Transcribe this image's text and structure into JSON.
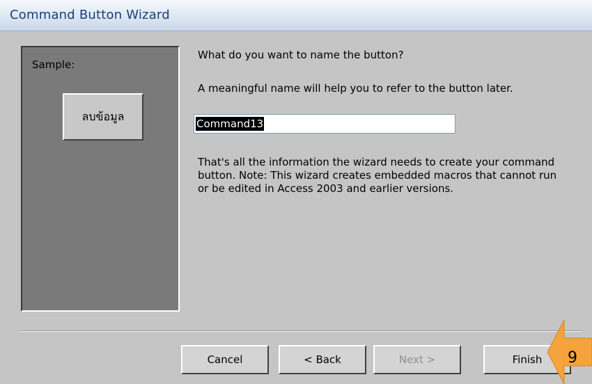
{
  "window": {
    "title": "Command Button Wizard"
  },
  "sample": {
    "label": "Sample:",
    "button_text": "ลบข้อมูล"
  },
  "content": {
    "question": "What do you want to name the button?",
    "hint": "A meaningful name will help you to refer to the button later.",
    "name_value": "Command13",
    "info": "That's all the information the wizard needs to create your command button. Note: This wizard creates embedded macros that cannot run or be edited in Access 2003 and earlier versions."
  },
  "buttons": {
    "cancel": "Cancel",
    "back": "< Back",
    "next": "Next >",
    "finish": "Finish"
  },
  "callout": {
    "number": "9",
    "color": "#f5a33c"
  }
}
